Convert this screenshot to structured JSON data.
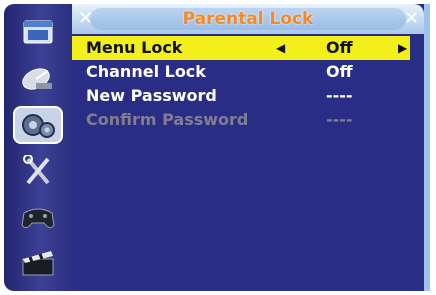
{
  "sidebar": {
    "items": [
      {
        "icon": "system-window-icon",
        "selected": false
      },
      {
        "icon": "satellite-dish-icon",
        "selected": false
      },
      {
        "icon": "gear-settings-icon",
        "selected": true
      },
      {
        "icon": "tools-icon",
        "selected": false
      },
      {
        "icon": "gamepad-icon",
        "selected": false
      },
      {
        "icon": "clapperboard-icon",
        "selected": false
      }
    ]
  },
  "header": {
    "title": "Parental Lock"
  },
  "menu": {
    "rows": [
      {
        "label": "Menu Lock",
        "value": "Off",
        "selected": true,
        "disabled": false
      },
      {
        "label": "Channel Lock",
        "value": "Off",
        "selected": false,
        "disabled": false
      },
      {
        "label": "New Password",
        "value": "----",
        "selected": false,
        "disabled": false
      },
      {
        "label": "Confirm Password",
        "value": "----",
        "selected": false,
        "disabled": true
      }
    ]
  },
  "colors": {
    "panel": "#2a2d86",
    "highlight": "#f2ef1a",
    "title": "#f28a2a",
    "disabled": "#7f7f90"
  }
}
